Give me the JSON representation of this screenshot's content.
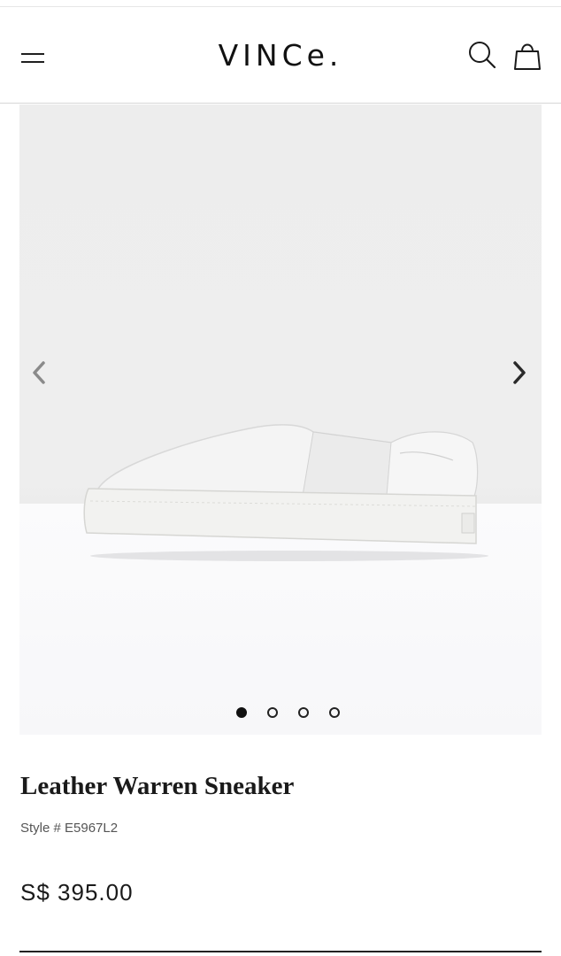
{
  "header": {
    "brand": "VINCe.",
    "menu_icon": "hamburger-menu-icon",
    "search_icon": "search-icon",
    "bag_icon": "shopping-bag-icon"
  },
  "gallery": {
    "image_subject": "white leather slip-on platform sneaker",
    "prev_icon": "chevron-left-icon",
    "next_icon": "chevron-right-icon",
    "slide_count": 4,
    "active_slide": 1
  },
  "product": {
    "name": "Leather Warren Sneaker",
    "style": "Style # E5967L2",
    "price": "S$ 395.00"
  },
  "colors": {
    "text": "#1a1a1a",
    "gallery_bg": "#ededed",
    "divider": "#222222"
  }
}
